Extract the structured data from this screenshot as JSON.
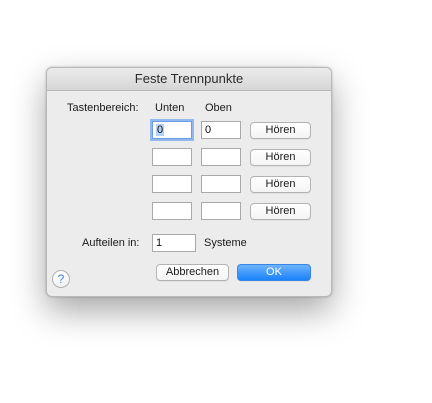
{
  "dialog": {
    "title": "Feste Trennpunkte",
    "range_label": "Tastenbereich:",
    "col_lower": "Unten",
    "col_upper": "Oben",
    "rows": [
      {
        "lower": "0",
        "upper": "0",
        "button": "Hören"
      },
      {
        "lower": "",
        "upper": "",
        "button": "Hören"
      },
      {
        "lower": "",
        "upper": "",
        "button": "Hören"
      },
      {
        "lower": "",
        "upper": "",
        "button": "Hören"
      }
    ],
    "split_label": "Aufteilen in:",
    "split_value": "1",
    "split_unit": "Systeme",
    "help_glyph": "?",
    "cancel_label": "Abbrechen",
    "ok_label": "OK"
  },
  "colors": {
    "accent": "#1a82fb",
    "focus_ring": "#93b8ee",
    "dialog_bg": "#ececec"
  },
  "icons": {
    "help": "help-icon"
  }
}
